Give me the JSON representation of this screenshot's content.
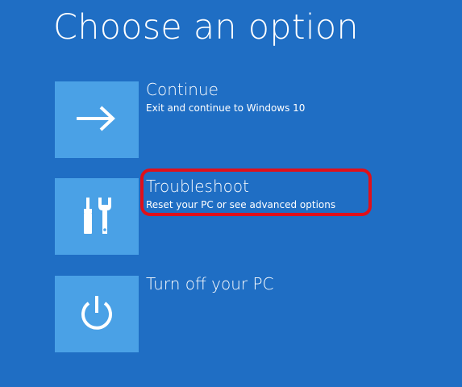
{
  "page": {
    "title": "Choose an option"
  },
  "options": [
    {
      "label": "Continue",
      "description": "Exit and continue to Windows 10",
      "icon": "arrow-right-icon"
    },
    {
      "label": "Troubleshoot",
      "description": "Reset your PC or see advanced options",
      "icon": "tools-icon",
      "highlighted": true
    },
    {
      "label": "Turn off your PC",
      "description": "",
      "icon": "power-icon"
    }
  ],
  "colors": {
    "background": "#1f6ec4",
    "tile": "#4aa1e6",
    "highlight": "#e0101a",
    "text": "#ffffff"
  }
}
